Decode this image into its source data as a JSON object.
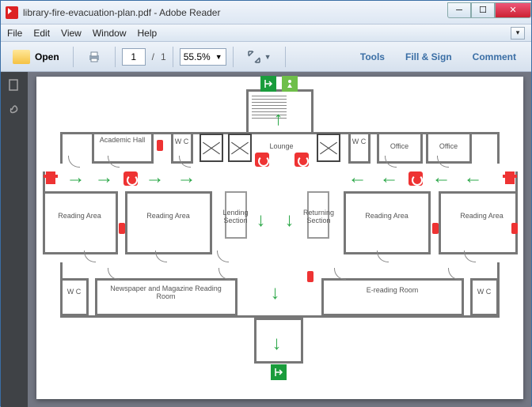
{
  "window": {
    "title": "library-fire-evacuation-plan.pdf - Adobe Reader"
  },
  "menu": {
    "file": "File",
    "edit": "Edit",
    "view": "View",
    "window": "Window",
    "help": "Help"
  },
  "toolbar": {
    "open": "Open",
    "page_current": "1",
    "page_sep": "/",
    "page_total": "1",
    "zoom": "55.5%",
    "tools": "Tools",
    "fillsign": "Fill & Sign",
    "comment": "Comment"
  },
  "plan": {
    "rooms": {
      "academic_hall": "Academic Hall",
      "wc1": "W C",
      "lounge": "Lounge",
      "wc2": "W C",
      "office1": "Office",
      "office2": "Office",
      "reading_area": "Reading Area",
      "lending": "Lending Section",
      "returning": "Returning Section",
      "newspaper": "Newspaper and Magazine Reading Room",
      "ereading": "E-reading Room",
      "wc3": "W C",
      "wc4": "W C"
    }
  }
}
